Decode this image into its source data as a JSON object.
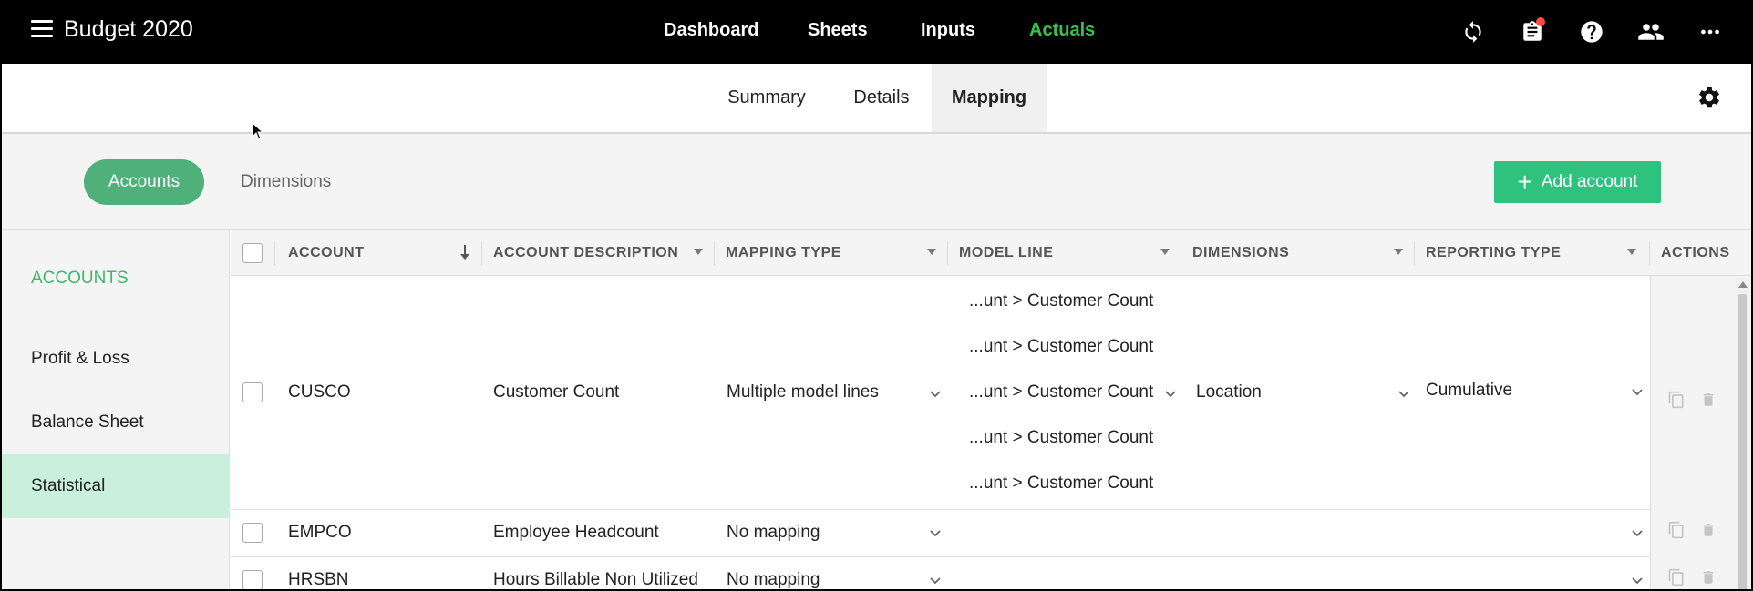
{
  "app": {
    "title": "Budget 2020"
  },
  "topnav": [
    "Dashboard",
    "Sheets",
    "Inputs",
    "Actuals"
  ],
  "topnav_active": "Actuals",
  "subtabs": [
    "Summary",
    "Details",
    "Mapping"
  ],
  "subtab_active": "Mapping",
  "toolbar": {
    "accounts": "Accounts",
    "dimensions": "Dimensions",
    "add_account": "Add account"
  },
  "leftpanel": {
    "heading": "ACCOUNTS",
    "items": [
      "Profit & Loss",
      "Balance Sheet",
      "Statistical"
    ],
    "active": "Statistical"
  },
  "grid": {
    "headers": [
      "ACCOUNT",
      "ACCOUNT DESCRIPTION",
      "MAPPING TYPE",
      "MODEL LINE",
      "DIMENSIONS",
      "REPORTING TYPE",
      "ACTIONS"
    ],
    "rows": [
      {
        "account": "CUSCO",
        "description": "Customer Count",
        "mapping_type": "Multiple model lines",
        "model_lines": [
          "...unt > Customer Count",
          "...unt > Customer Count",
          "...unt > Customer Count",
          "...unt > Customer Count",
          "...unt > Customer Count"
        ],
        "dimensions": "Location",
        "reporting_type": "Cumulative"
      },
      {
        "account": "EMPCO",
        "description": "Employee Headcount",
        "mapping_type": "No mapping"
      },
      {
        "account": "HRSBN",
        "description": "Hours Billable Non Utilized",
        "mapping_type": "No mapping"
      }
    ]
  },
  "colors": {
    "accent": "#35c24f",
    "primary_button": "#2ec27e",
    "pill": "#4fb07a",
    "active_item_bg": "#c9f0dc",
    "notification": "#ff4d3d"
  }
}
